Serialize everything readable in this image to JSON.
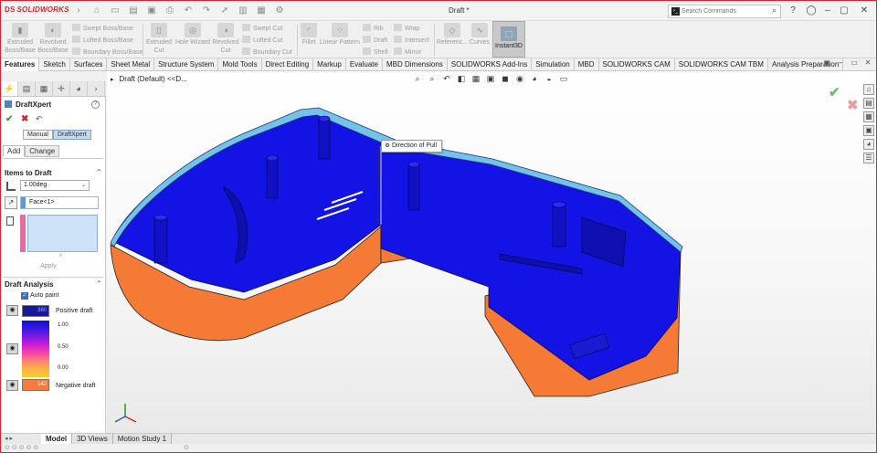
{
  "app": {
    "logo_text": "SOLIDWORKS",
    "document_title": "Draft *",
    "search": {
      "placeholder": "Search Commands"
    }
  },
  "ribbon": {
    "large_buttons": [
      {
        "line1": "Extruded",
        "line2": "Boss/Base"
      },
      {
        "line1": "Revolved",
        "line2": "Boss/Base"
      },
      {
        "line1": "Extruded",
        "line2": "Cut"
      },
      {
        "line1": "Hole Wizard",
        "line2": ""
      },
      {
        "line1": "Revolved",
        "line2": "Cut"
      },
      {
        "line1": "Fillet",
        "line2": ""
      },
      {
        "line1": "Linear Pattern",
        "line2": ""
      },
      {
        "line1": "Referenc...",
        "line2": ""
      },
      {
        "line1": "Curves",
        "line2": ""
      }
    ],
    "boss_small": [
      "Swept Boss/Base",
      "Lofted Boss/Base",
      "Boundary Boss/Base"
    ],
    "cut_small": [
      "Swept Cut",
      "Lofted Cut",
      "Boundary Cut"
    ],
    "rib_small": [
      "Rib",
      "Draft",
      "Shell"
    ],
    "wrap_small": [
      "Wrap",
      "Intersect",
      "Mirror"
    ],
    "instant3d": "Instant3D"
  },
  "command_tabs": [
    "Features",
    "Sketch",
    "Surfaces",
    "Sheet Metal",
    "Structure System",
    "Mold Tools",
    "Direct Editing",
    "Markup",
    "Evaluate",
    "MBD Dimensions",
    "SOLIDWORKS Add-Ins",
    "Simulation",
    "MBD",
    "SOLIDWORKS CAM",
    "SOLIDWORKS CAM TBM",
    "Analysis Preparation"
  ],
  "property_manager": {
    "title": "DraftXpert",
    "modes": [
      "Manual",
      "DraftXpert"
    ],
    "tabs": [
      "Add",
      "Change"
    ],
    "items_to_draft": {
      "header": "Items to Draft",
      "angle_value": "1.00deg",
      "neutral_plane": "Face<1>",
      "apply_label": "Apply"
    },
    "draft_analysis": {
      "header": "Draft Analysis",
      "auto_paint_label": "Auto paint",
      "positive_label": "Positive draft",
      "positive_count": "380",
      "negative_label": "Negative draft",
      "negative_count": "142",
      "scale": [
        "1.00",
        "0.50",
        "0.00"
      ],
      "colors": {
        "positive": "#16199b",
        "negative": "#f47c40"
      }
    }
  },
  "viewport": {
    "breadcrumb": "Draft  (Default) <<D...",
    "callout": "Direction of Pull",
    "colors": {
      "positive_draft_face": "#1313e6",
      "negative_draft_face": "#f47a36",
      "rim": "#74c2ec"
    }
  },
  "bottom_tabs": [
    "Model",
    "3D Views",
    "Motion Study 1"
  ]
}
